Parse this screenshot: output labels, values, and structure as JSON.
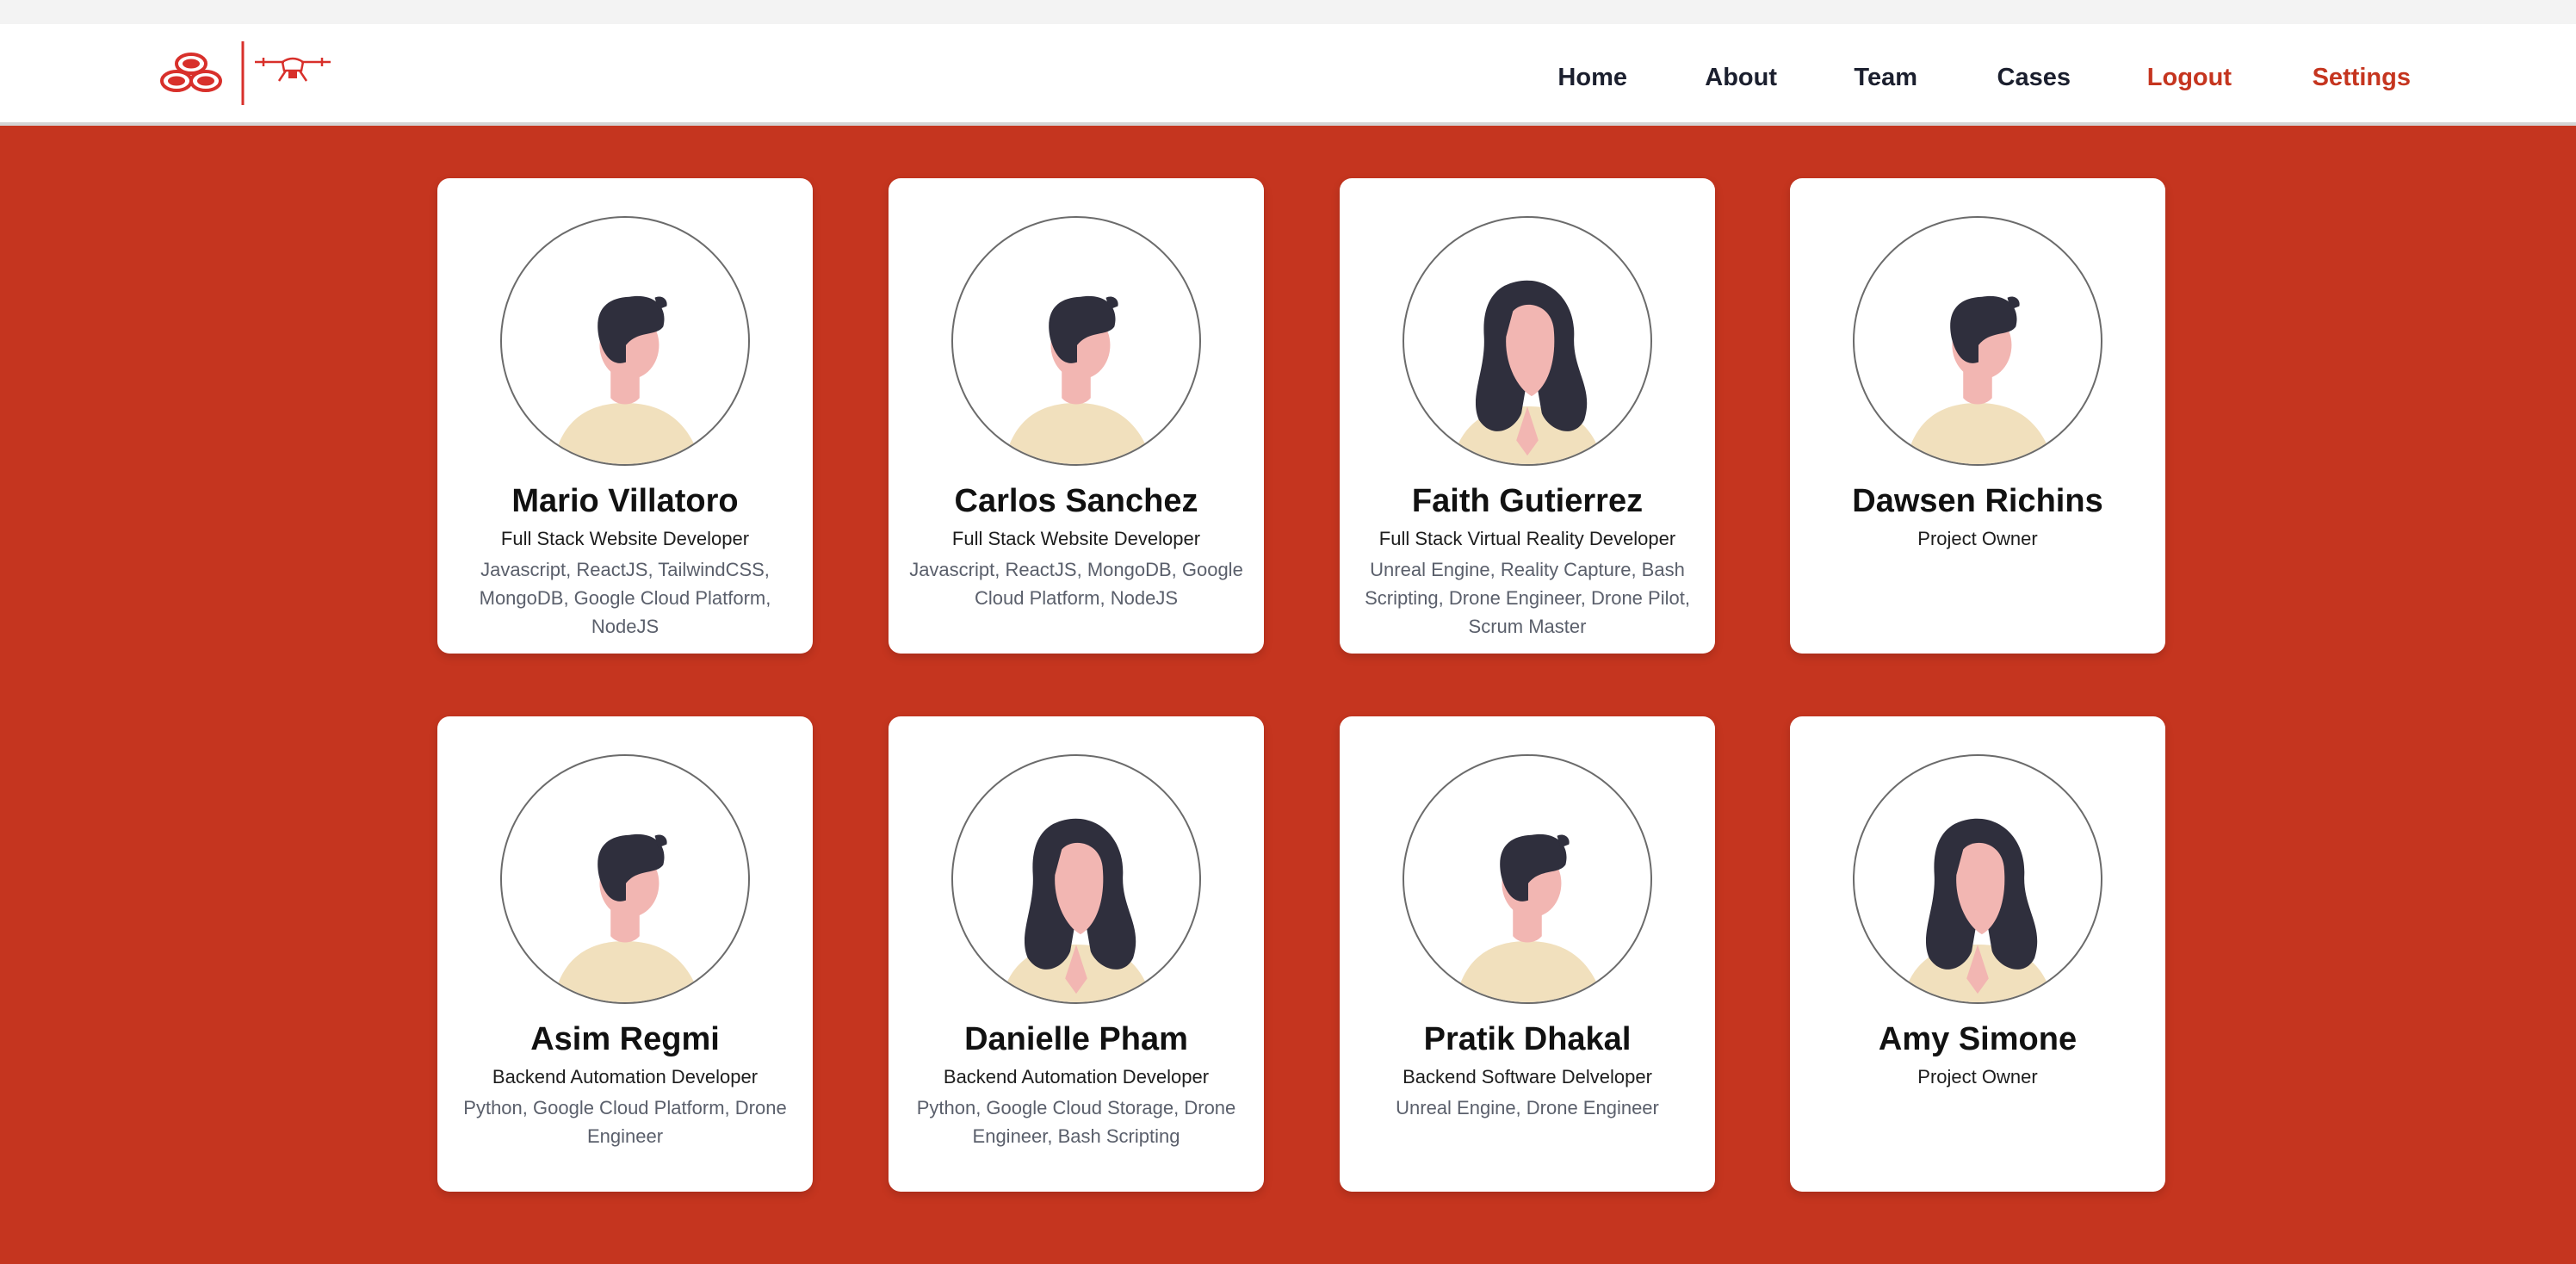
{
  "nav": {
    "links": [
      "Home",
      "About",
      "Team",
      "Cases",
      "Logout",
      "Settings"
    ],
    "accent_color": "#c5351f",
    "logo_icons": [
      "ovals-logo-icon",
      "drone-icon"
    ]
  },
  "team": [
    {
      "name": "Mario Villatoro",
      "role": "Full Stack Website Developer",
      "skills": "Javascript, ReactJS, TailwindCSS, MongoDB, Google Cloud Platform, NodeJS",
      "avatar": "male-avatar"
    },
    {
      "name": "Carlos Sanchez",
      "role": "Full Stack Website Developer",
      "skills": "Javascript, ReactJS, MongoDB, Google Cloud Platform, NodeJS",
      "avatar": "male-avatar"
    },
    {
      "name": "Faith Gutierrez",
      "role": "Full Stack Virtual Reality Developer",
      "skills": "Unreal Engine, Reality Capture, Bash Scripting, Drone Engineer, Drone Pilot, Scrum Master",
      "avatar": "female-avatar"
    },
    {
      "name": "Dawsen Richins",
      "role": "Project Owner",
      "skills": "",
      "avatar": "male-avatar"
    },
    {
      "name": "Asim Regmi",
      "role": "Backend Automation Developer",
      "skills": "Python, Google Cloud Platform, Drone Engineer",
      "avatar": "male-avatar"
    },
    {
      "name": "Danielle Pham",
      "role": "Backend Automation Developer",
      "skills": "Python, Google Cloud Storage, Drone Engineer, Bash Scripting",
      "avatar": "female-avatar"
    },
    {
      "name": "Pratik Dhakal",
      "role": "Backend Software Delveloper",
      "skills": "Unreal Engine, Drone Engineer",
      "avatar": "male-avatar"
    },
    {
      "name": "Amy Simone",
      "role": "Project Owner",
      "skills": "",
      "avatar": "female-avatar"
    }
  ]
}
